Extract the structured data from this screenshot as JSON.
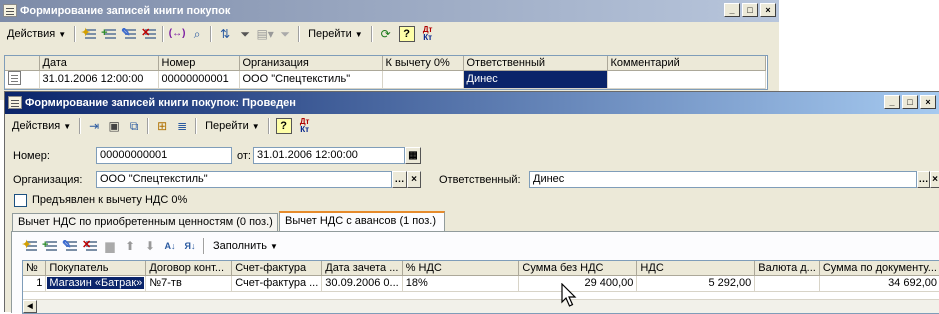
{
  "colors": {
    "title_gradient_start": "#0a246a",
    "title_gradient_end": "#a6caf0",
    "selection": "#0a246a",
    "face": "#ece9d8"
  },
  "back_window": {
    "title": "Формирование записей книги покупок",
    "toolbar": {
      "actions_label": "Действия",
      "goto_label": "Перейти",
      "help_icon": "?"
    },
    "columns": [
      "",
      "Дата",
      "Номер",
      "Организация",
      "К вычету 0%",
      "Ответственный",
      "Комментарий"
    ],
    "rows": [
      {
        "icon": "document-icon",
        "date": "31.01.2006 12:00:00",
        "number": "00000000001",
        "org": "ООО \"Спецтекстиль\"",
        "deduct0": "",
        "responsible": "Динес",
        "comment": ""
      }
    ]
  },
  "front_window": {
    "title": "Формирование записей книги покупок: Проведен",
    "toolbar": {
      "actions_label": "Действия",
      "goto_label": "Перейти",
      "help_icon": "?"
    },
    "form": {
      "number_label": "Номер:",
      "number_value": "00000000001",
      "date_label": "от:",
      "date_value": "31.01.2006 12:00:00",
      "org_label": "Организация:",
      "org_value": "ООО \"Спецтекстиль\"",
      "responsible_label": "Ответственный:",
      "responsible_value": "Динес",
      "checkbox_label": "Предъявлен к вычету НДС 0%",
      "checkbox_checked": false
    },
    "tabs": [
      {
        "label": "Вычет НДС по приобретенным ценностям (0 поз.)",
        "active": false
      },
      {
        "label": "Вычет НДС с авансов (1 поз.)",
        "active": true
      }
    ],
    "tab_toolbar": {
      "fill_label": "Заполнить"
    },
    "columns": [
      "№",
      "Покупатель",
      "Договор конт...",
      "Счет-фактура",
      "Дата зачета ...",
      "% НДС",
      "Сумма без НДС",
      "НДС",
      "Валюта д...",
      "Сумма по документу..."
    ],
    "rows": [
      {
        "n": "1",
        "buyer": "Магазин «Батрак»",
        "contract": "№7-тв",
        "invoice": "Счет-фактура ...",
        "offset_date": "30.09.2006 0...",
        "vat_rate": "18%",
        "sum_no_vat": "29 400,00",
        "vat": "5 292,00",
        "currency": "",
        "doc_sum": "34 692,00"
      }
    ]
  }
}
